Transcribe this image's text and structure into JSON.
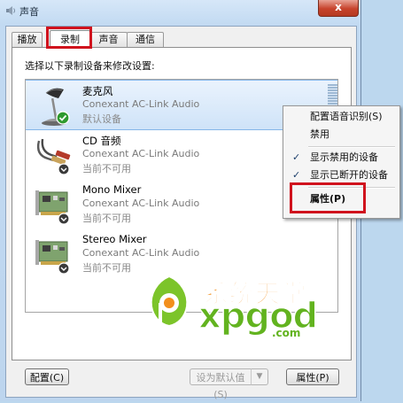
{
  "window": {
    "title": "声音",
    "close_label": "x"
  },
  "tabs": [
    {
      "label": "播放",
      "active": false
    },
    {
      "label": "录制",
      "active": true
    },
    {
      "label": "声音",
      "active": false
    },
    {
      "label": "通信",
      "active": false
    }
  ],
  "instruction": "选择以下录制设备来修改设置:",
  "devices": [
    {
      "name": "麦克风",
      "driver": "Conexant AC-Link Audio",
      "status": "默认设备",
      "icon": "microphone-icon",
      "selected": true
    },
    {
      "name": "CD 音频",
      "driver": "Conexant AC-Link Audio",
      "status": "当前不可用",
      "icon": "cd-audio-cable-icon",
      "selected": false
    },
    {
      "name": "Mono Mixer",
      "driver": "Conexant AC-Link Audio",
      "status": "当前不可用",
      "icon": "sound-card-icon",
      "selected": false
    },
    {
      "name": "Stereo Mixer",
      "driver": "Conexant AC-Link Audio",
      "status": "当前不可用",
      "icon": "sound-card-icon",
      "selected": false
    }
  ],
  "buttons": {
    "configure": "配置(C)",
    "set_default": "设为默认值(S)",
    "properties": "属性(P)"
  },
  "context_menu": [
    {
      "label": "配置语音识别(S)",
      "checked": false
    },
    {
      "label": "禁用",
      "checked": false
    },
    {
      "label": "显示禁用的设备",
      "checked": true
    },
    {
      "label": "显示已断开的设备",
      "checked": true
    },
    {
      "label": "属性(P)",
      "checked": false,
      "bold": true
    }
  ],
  "watermark": {
    "cn": "系统天堂",
    "en": "xpgod",
    "domain": ".com"
  },
  "colors": {
    "highlight_red": "#d0121d",
    "selection_blue": "#cfe3f8",
    "watermark_green": "#62b31f",
    "watermark_orange": "#f28f1c"
  }
}
